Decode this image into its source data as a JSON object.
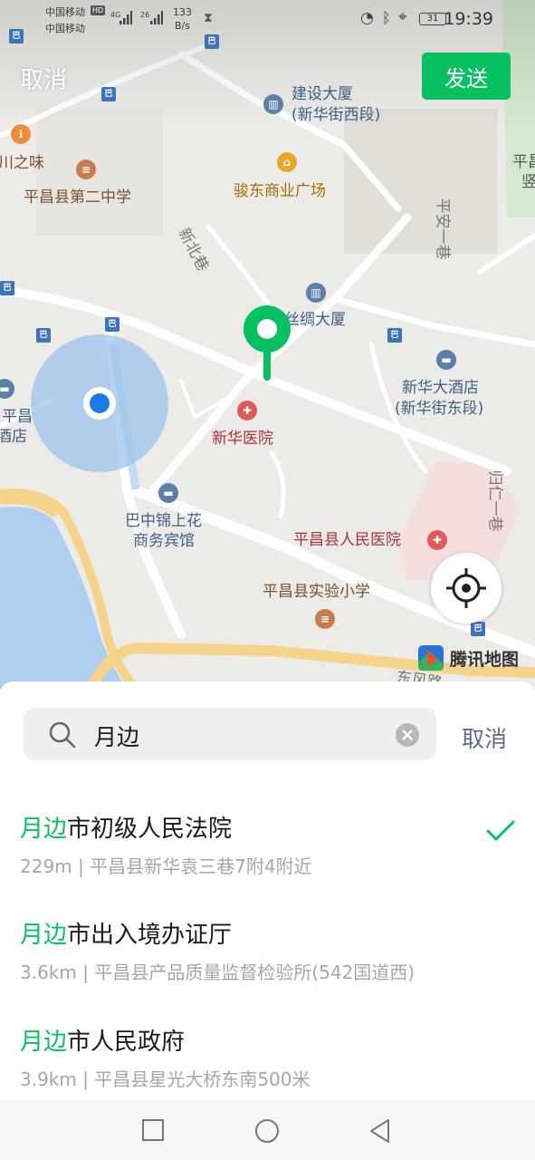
{
  "status_bar": {
    "carrier1": "中国移动",
    "carrier1_badge": "HD",
    "carrier2": "中国移动",
    "signal1": "4G",
    "signal2": "26",
    "speed_value": "133",
    "speed_unit": "B/s",
    "battery": "31",
    "time": "19:39"
  },
  "header": {
    "cancel_label": "取消",
    "send_label": "发送"
  },
  "map": {
    "pois": [
      {
        "name": "建设大厦",
        "sub": "(新华街西段)"
      },
      {
        "name": "川之味"
      },
      {
        "name": "平昌县第二中学"
      },
      {
        "name": "骏东商业广场"
      },
      {
        "name": "丝绸大厦"
      },
      {
        "name": "新华大酒店",
        "sub": "(新华街东段)"
      },
      {
        "name": "新华医院"
      },
      {
        "name": "巴中锦上花",
        "sub": "商务宾馆"
      },
      {
        "name": "平昌县人民医院"
      },
      {
        "name": "平昌县实验小学"
      },
      {
        "name": "平昌",
        "sub": "酒店"
      },
      {
        "name": "平昌",
        "sub": "竖"
      }
    ],
    "roads": [
      "新北巷",
      "平安一巷",
      "归仁一巷",
      "东风路"
    ],
    "logo": "腾讯地图",
    "colors": {
      "accent": "#07c160",
      "location_dot": "#1b7ae6",
      "location_halo": "#9fc3ec"
    }
  },
  "search": {
    "query": "月边",
    "cancel_label": "取消"
  },
  "results": [
    {
      "highlight": "月边",
      "rest": "市初级人民法院",
      "detail": "229m | 平昌县新华袁三巷7附4附近",
      "selected": true
    },
    {
      "highlight": "月边",
      "rest": "市出入境办证厅",
      "detail": "3.6km | 平昌县产品质量监督检验所(542国道西)",
      "selected": false
    },
    {
      "highlight": "月边",
      "rest": "市人民政府",
      "detail": "3.9km | 平昌县星光大桥东南500米",
      "selected": false
    }
  ]
}
